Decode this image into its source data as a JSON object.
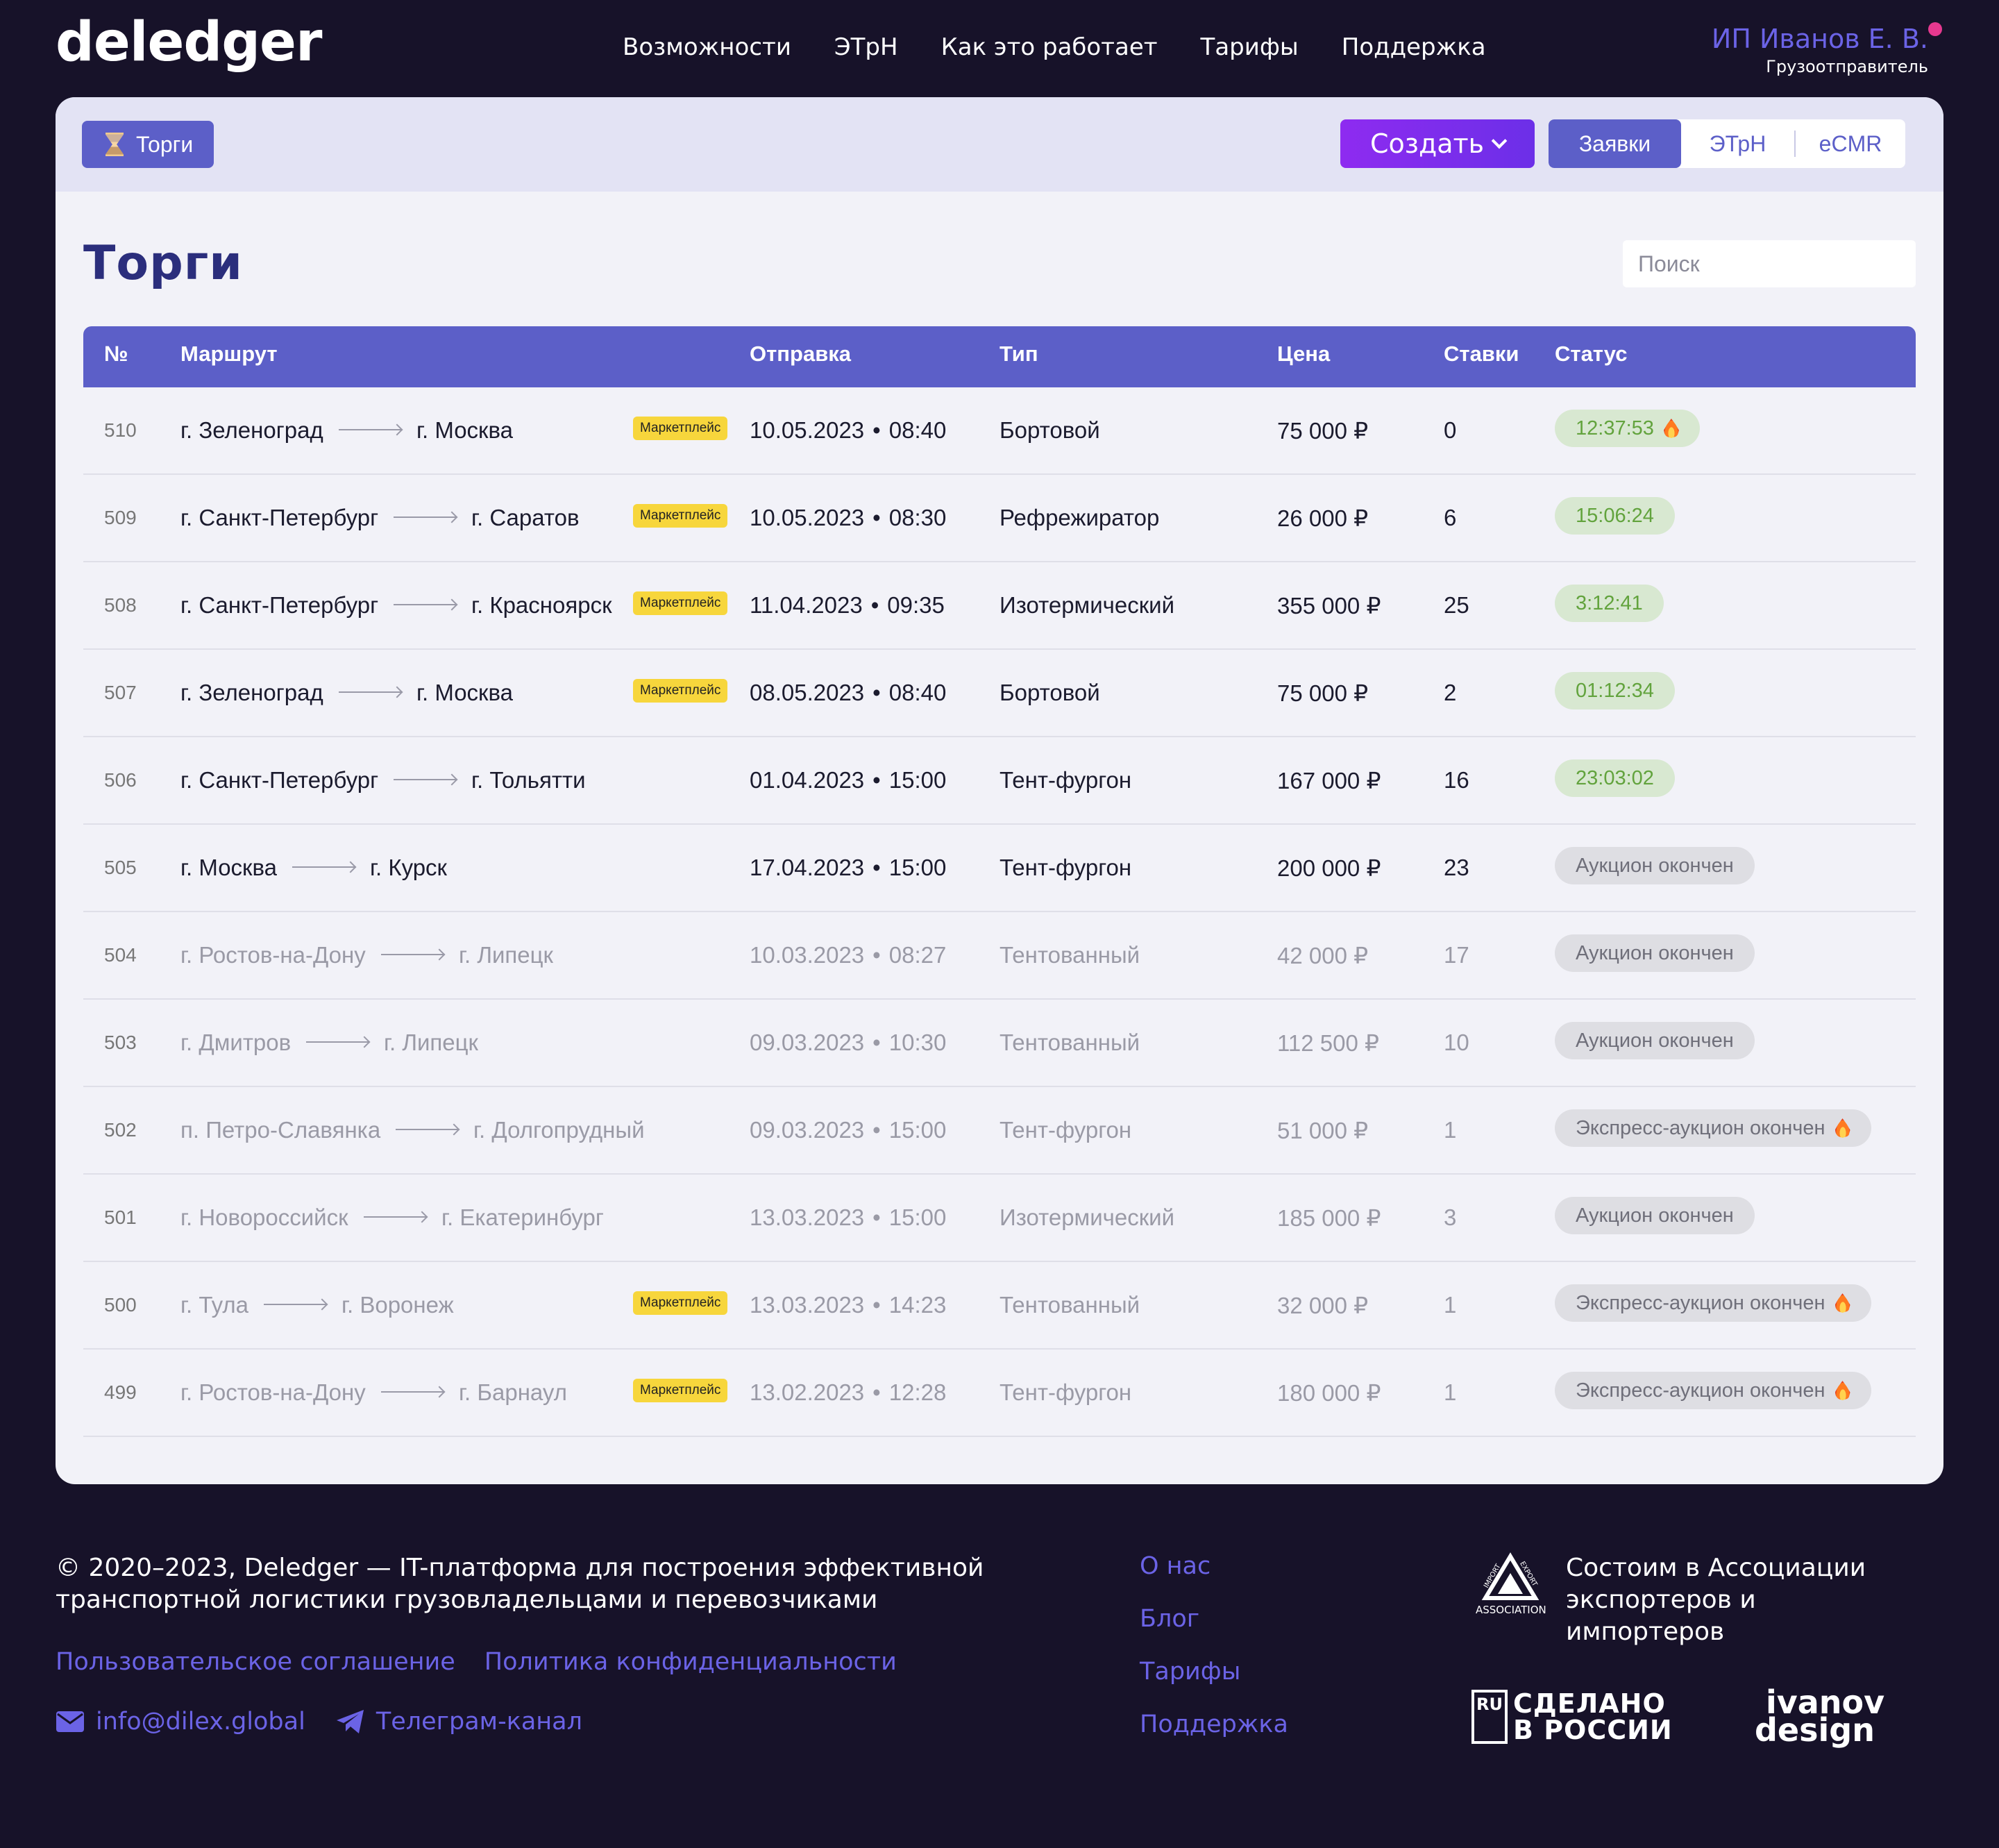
{
  "brand": {
    "logo": "deledger"
  },
  "nav": [
    "Возможности",
    "ЭТрН",
    "Как это работает",
    "Тарифы",
    "Поддержка"
  ],
  "user": {
    "name": "ИП Иванов Е. В.",
    "role": "Грузоотправитель",
    "notify_color": "#e6398f"
  },
  "toolbar": {
    "breadcrumb": "Торги",
    "create_label": "Создать",
    "segments": [
      "Заявки",
      "ЭТрН",
      "eCMR"
    ],
    "active_segment": "Заявки"
  },
  "page": {
    "title": "Торги",
    "search_placeholder": "Поиск"
  },
  "table": {
    "headers": {
      "id": "№",
      "route": "Маршрут",
      "departure": "Отправка",
      "type": "Тип",
      "price": "Цена",
      "bids": "Ставки",
      "status": "Статус"
    },
    "tag_label": "Маркетплейс",
    "rows": [
      {
        "id": "510",
        "from": "г. Зеленоград",
        "to": "г. Москва",
        "tag": true,
        "date": "10.05.2023",
        "time": "08:40",
        "type": "Бортовой",
        "price": "75 000 ₽",
        "bids": "0",
        "status": "12:37:53",
        "status_kind": "timer",
        "fire": true,
        "muted": false
      },
      {
        "id": "509",
        "from": "г. Санкт-Петербург",
        "to": "г. Саратов",
        "tag": true,
        "date": "10.05.2023",
        "time": "08:30",
        "type": "Рефрежиратор",
        "price": "26 000 ₽",
        "bids": "6",
        "status": "15:06:24",
        "status_kind": "timer",
        "fire": false,
        "muted": false
      },
      {
        "id": "508",
        "from": "г. Санкт-Петербург",
        "to": "г. Красноярск",
        "tag": true,
        "date": "11.04.2023",
        "time": "09:35",
        "type": "Изотермический",
        "price": "355 000 ₽",
        "bids": "25",
        "status": "3:12:41",
        "status_kind": "timer",
        "fire": false,
        "muted": false
      },
      {
        "id": "507",
        "from": "г. Зеленоград",
        "to": "г. Москва",
        "tag": true,
        "date": "08.05.2023",
        "time": "08:40",
        "type": "Бортовой",
        "price": "75 000 ₽",
        "bids": "2",
        "status": "01:12:34",
        "status_kind": "timer",
        "fire": false,
        "muted": false
      },
      {
        "id": "506",
        "from": "г. Санкт-Петербург",
        "to": "г. Тольятти",
        "tag": false,
        "date": "01.04.2023",
        "time": "15:00",
        "type": "Тент-фургон",
        "price": "167 000 ₽",
        "bids": "16",
        "status": "23:03:02",
        "status_kind": "timer",
        "fire": false,
        "muted": false
      },
      {
        "id": "505",
        "from": "г. Москва",
        "to": "г. Курск",
        "tag": false,
        "date": "17.04.2023",
        "time": "15:00",
        "type": "Тент-фургон",
        "price": "200 000 ₽",
        "bids": "23",
        "status": "Аукцион окончен",
        "status_kind": "done",
        "fire": false,
        "muted": false
      },
      {
        "id": "504",
        "from": "г. Ростов-на-Дону",
        "to": "г. Липецк",
        "tag": false,
        "date": "10.03.2023",
        "time": "08:27",
        "type": "Тентованный",
        "price": "42 000 ₽",
        "bids": "17",
        "status": "Аукцион окончен",
        "status_kind": "done",
        "fire": false,
        "muted": true
      },
      {
        "id": "503",
        "from": "г. Дмитров",
        "to": "г. Липецк",
        "tag": false,
        "date": "09.03.2023",
        "time": "10:30",
        "type": "Тентованный",
        "price": "112 500 ₽",
        "bids": "10",
        "status": "Аукцион окончен",
        "status_kind": "done",
        "fire": false,
        "muted": true
      },
      {
        "id": "502",
        "from": "п. Петро-Славянка",
        "to": "г. Долгопрудный",
        "tag": false,
        "date": "09.03.2023",
        "time": "15:00",
        "type": "Тент-фургон",
        "price": "51 000 ₽",
        "bids": "1",
        "status": "Экспресс-аукцион окончен",
        "status_kind": "done",
        "fire": true,
        "muted": true
      },
      {
        "id": "501",
        "from": "г. Новороссийск",
        "to": "г. Екатеринбург",
        "tag": false,
        "date": "13.03.2023",
        "time": "15:00",
        "type": "Изотермический",
        "price": "185 000 ₽",
        "bids": "3",
        "status": "Аукцион окончен",
        "status_kind": "done",
        "fire": false,
        "muted": true
      },
      {
        "id": "500",
        "from": "г. Тула",
        "to": "г. Воронеж",
        "tag": true,
        "date": "13.03.2023",
        "time": "14:23",
        "type": "Тентованный",
        "price": "32 000 ₽",
        "bids": "1",
        "status": "Экспресс-аукцион окончен",
        "status_kind": "done",
        "fire": true,
        "muted": true
      },
      {
        "id": "499",
        "from": "г. Ростов-на-Дону",
        "to": "г. Барнаул",
        "tag": true,
        "date": "13.02.2023",
        "time": "12:28",
        "type": "Тент-фургон",
        "price": "180 000 ₽",
        "bids": "1",
        "status": "Экспресс-аукцион окончен",
        "status_kind": "done",
        "fire": true,
        "muted": true
      }
    ]
  },
  "footer": {
    "copyright": "© 2020–2023, Deledger — IT-платформа для построения эффективной транспортной логистики грузовладельцами и перевозчиками",
    "legal_links": [
      "Пользовательское соглашение",
      "Политика конфиденциальности"
    ],
    "email": "info@dilex.global",
    "telegram": "Телеграм-канал",
    "nav": [
      "О нас",
      "Блог",
      "Тарифы",
      "Поддержка"
    ],
    "association": "Состоим в Ассоциации экспортеров и импортеров",
    "association_logo_text": [
      "IMPORT",
      "EXPORT",
      "ASSOCIATION"
    ],
    "made_in_russia": {
      "box": "RU",
      "text": [
        "СДЕЛАНО",
        "В РОССИИ"
      ]
    },
    "designer": {
      "line1": "ivanov",
      "line2": "design"
    }
  },
  "colors": {
    "accent": "#5c5fc8",
    "link": "#6b63e6",
    "background": "#171229",
    "tag": "#f7d63c",
    "timer_bg": "#d8e8d1",
    "timer_fg": "#62a33d"
  }
}
